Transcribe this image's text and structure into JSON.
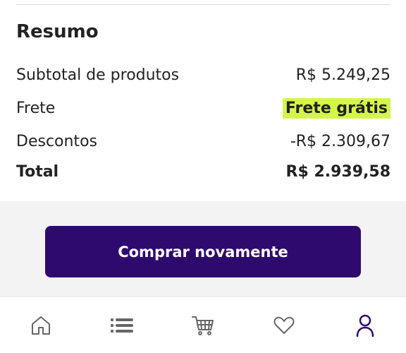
{
  "summary": {
    "title": "Resumo",
    "rows": [
      {
        "label": "Subtotal de produtos",
        "value": "R$ 5.249,25"
      },
      {
        "label": "Frete",
        "value": "Frete grátis"
      },
      {
        "label": "Descontos",
        "value": "-R$ 2.309,67"
      },
      {
        "label": "Total",
        "value": "R$ 2.939,58"
      }
    ]
  },
  "actions": {
    "buy_again_label": "Comprar novamente"
  },
  "nav": {
    "items": [
      {
        "icon": "home-icon",
        "active": false
      },
      {
        "icon": "list-icon",
        "active": false
      },
      {
        "icon": "cart-icon",
        "active": false
      },
      {
        "icon": "heart-icon",
        "active": false
      },
      {
        "icon": "account-icon",
        "active": true
      }
    ]
  },
  "colors": {
    "primary": "#2f0a6e",
    "highlight": "#d4f54a",
    "discount": "#8bb81f",
    "icon_inactive": "#666666",
    "icon_active": "#2f0a6e"
  }
}
